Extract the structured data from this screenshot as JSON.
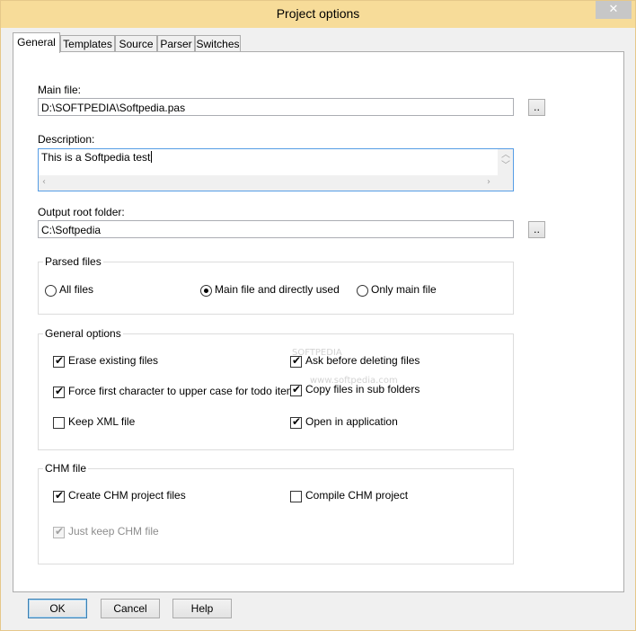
{
  "window": {
    "title": "Project options",
    "close_glyph": "✕"
  },
  "tabs": [
    {
      "label": "General",
      "active": true
    },
    {
      "label": "Templates"
    },
    {
      "label": "Source"
    },
    {
      "label": "Parser"
    },
    {
      "label": "Switches"
    }
  ],
  "main_file": {
    "label": "Main file:",
    "value": "D:\\SOFTPEDIA\\Softpedia.pas",
    "browse_label": ".."
  },
  "description": {
    "label": "Description:",
    "value": "This is a Softpedia test"
  },
  "output_root": {
    "label": "Output root folder:",
    "value": "C:\\Softpedia",
    "browse_label": ".."
  },
  "parsed_files": {
    "caption": "Parsed files",
    "options": [
      {
        "label": "All files",
        "selected": false
      },
      {
        "label": "Main file and directly used",
        "selected": true
      },
      {
        "label": "Only main file",
        "selected": false
      }
    ]
  },
  "general_options": {
    "caption": "General options",
    "items": {
      "erase": {
        "label": "Erase existing files",
        "checked": true
      },
      "ask": {
        "label": "Ask before deleting files",
        "checked": true
      },
      "force_upper": {
        "label": "Force first character to upper case for todo items",
        "checked": true
      },
      "copy_sub": {
        "label": "Copy files in sub folders",
        "checked": true
      },
      "keep_xml": {
        "label": "Keep XML file",
        "checked": false
      },
      "open_app": {
        "label": "Open in application",
        "checked": true
      }
    }
  },
  "chm_file": {
    "caption": "CHM file",
    "items": {
      "create": {
        "label": "Create CHM project files",
        "checked": true
      },
      "compile": {
        "label": "Compile CHM project",
        "checked": false
      },
      "just_keep": {
        "label": "Just keep CHM file",
        "checked": true,
        "disabled": true
      }
    }
  },
  "watermark": {
    "line1": "SOFTPEDIA",
    "line2": "www.softpedia.com"
  },
  "check_glyph": "✔",
  "buttons": {
    "ok": "OK",
    "cancel": "Cancel",
    "help": "Help"
  },
  "colors": {
    "titlebar": "#f7dc99",
    "focus_border": "#569de5"
  }
}
